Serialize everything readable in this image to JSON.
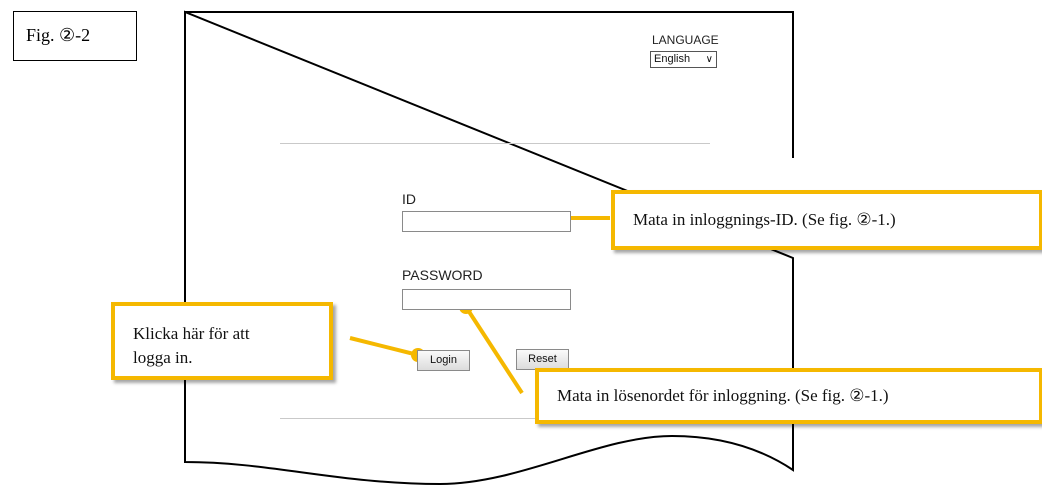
{
  "figure": {
    "label": "Fig. ②-2"
  },
  "login_page": {
    "language": {
      "label": "LANGUAGE",
      "selected": "English",
      "caret_icon": "chevron-down-icon"
    },
    "id_field": {
      "label": "ID",
      "value": ""
    },
    "password_field": {
      "label": "PASSWORD",
      "value": ""
    },
    "login_button": "Login",
    "reset_button": "Reset"
  },
  "callouts": {
    "id": "Mata in inloggnings-ID. (Se fig. ②-1.)",
    "login_line1": "Klicka här för att",
    "login_line2": "logga in.",
    "password": "Mata in lösenordet för inloggning. (Se fig. ②-1.)"
  },
  "colors": {
    "callout_accent": "#f5b800",
    "page_outline": "#000000",
    "divider": "#c9c9c9"
  }
}
